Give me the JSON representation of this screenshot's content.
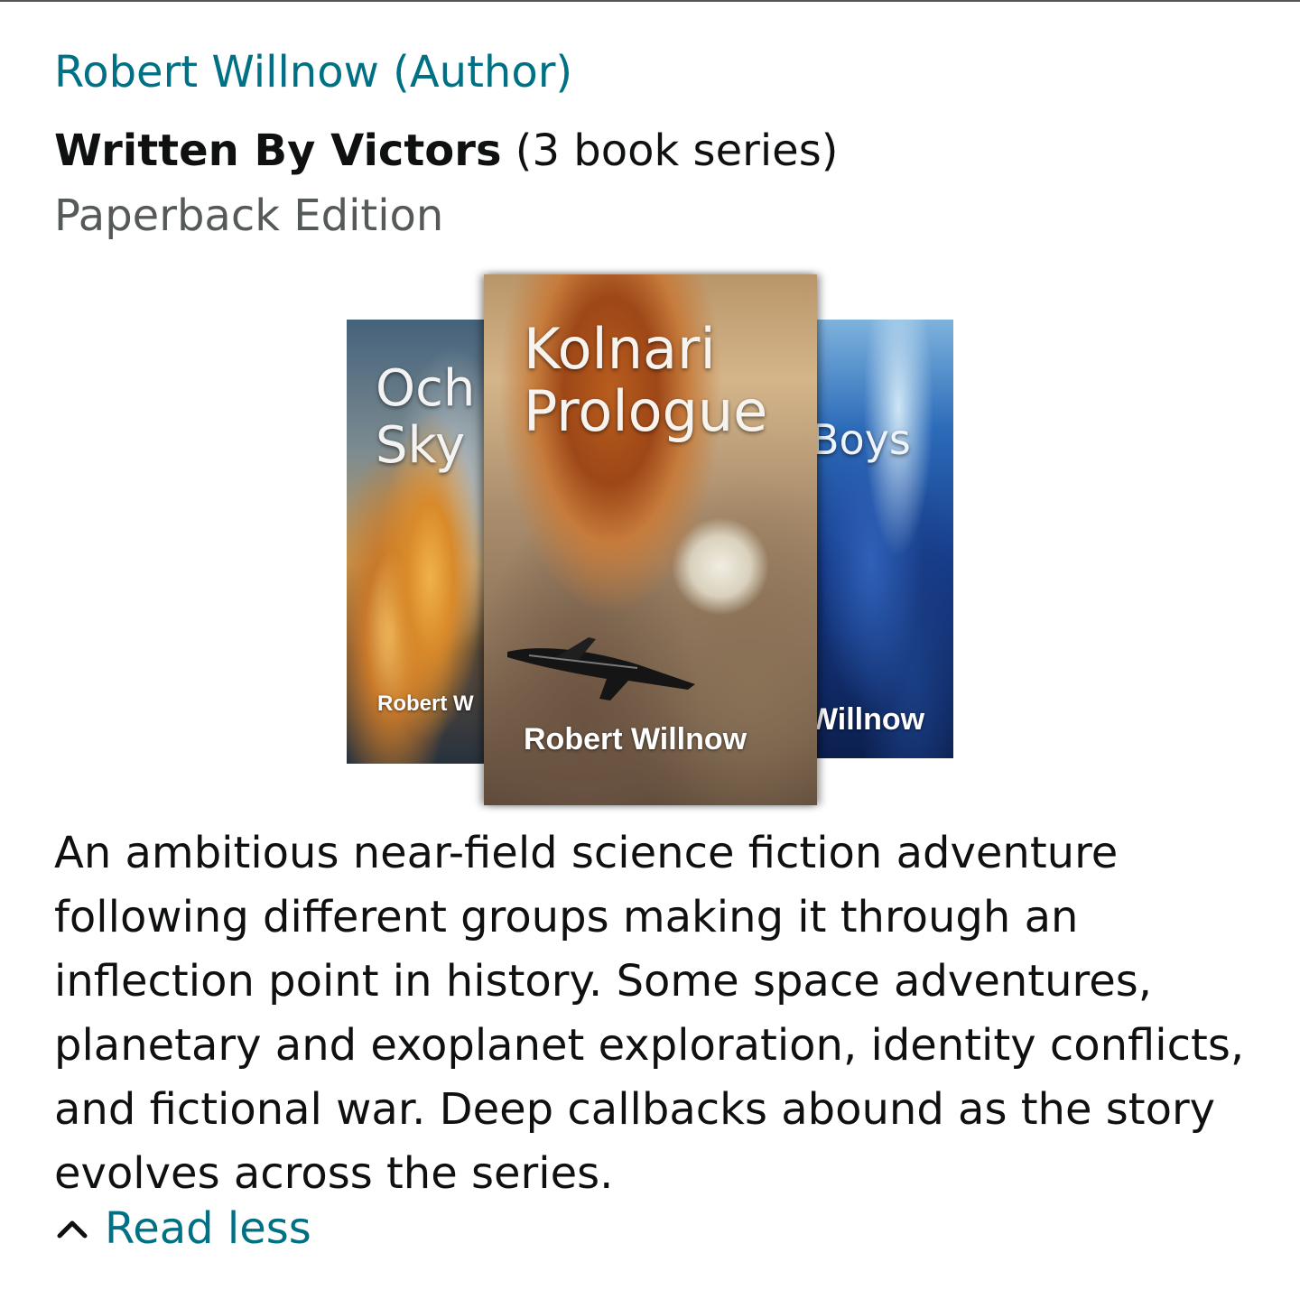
{
  "author": {
    "link_text": "Robert Willnow (Author)"
  },
  "series": {
    "name": "Written By Victors",
    "count_text": " (3 book series)"
  },
  "edition": "Paperback Edition",
  "covers": {
    "left": {
      "title": "Och\nSky",
      "author": "Robert W"
    },
    "center": {
      "title": "Kolnari\nPrologue",
      "author": "Robert Willnow"
    },
    "right": {
      "title": "Boys",
      "author": "Willnow"
    }
  },
  "description": "An ambitious near-field science fiction adventure following different groups making it through an inflection point in history. Some space adventures, planetary and exoplanet exploration, identity conflicts, and fictional war. Deep callbacks abound as the story evolves across the series.",
  "read_less": {
    "label": "Read less",
    "icon": "chevron-up-icon"
  },
  "colors": {
    "link": "#007185",
    "secondary_text": "#565959",
    "primary_text": "#0f1111"
  }
}
